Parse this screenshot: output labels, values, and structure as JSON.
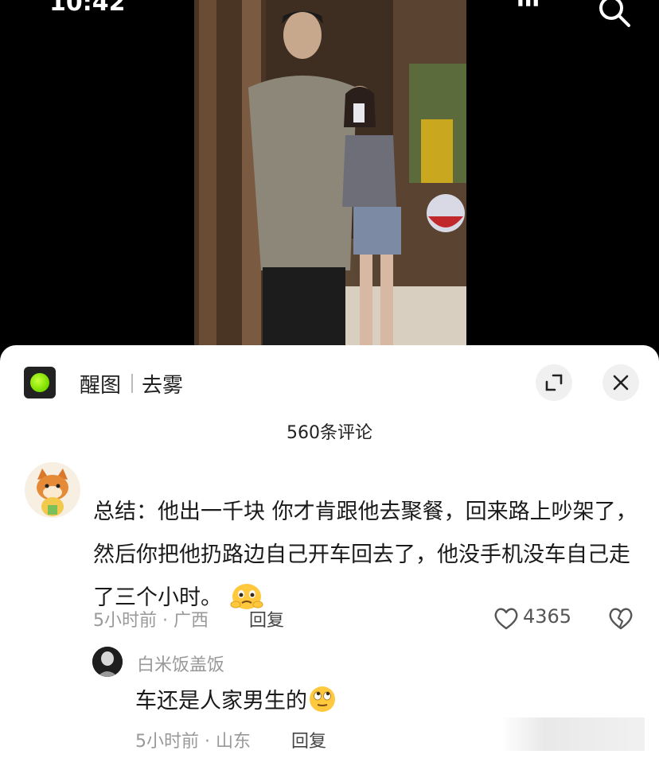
{
  "status_bar": {
    "time": "10:42"
  },
  "sheet": {
    "app_name": "醒图",
    "action_label": "去雾",
    "comment_count": "560条评论"
  },
  "comment": {
    "text": "总结：他出一千块 你才肯跟他去聚餐，回来路上吵架了，然后你把他扔路边自己开车回去了，他没手机没车自己走了三个小时。",
    "meta": "5小时前 · 广西",
    "reply_label": "回复",
    "likes": "4365",
    "emoji": "pleading-face-emoji"
  },
  "reply": {
    "username": "白米饭盖饭",
    "text": "车还是人家男生的",
    "meta": "5小时前 · 山东",
    "reply_label": "回复",
    "emoji": "rolling-eyes-emoji"
  },
  "colors": {
    "accent_green": "#7ee000",
    "meta_gray": "#999999",
    "text_dark": "#1a1a1a"
  }
}
